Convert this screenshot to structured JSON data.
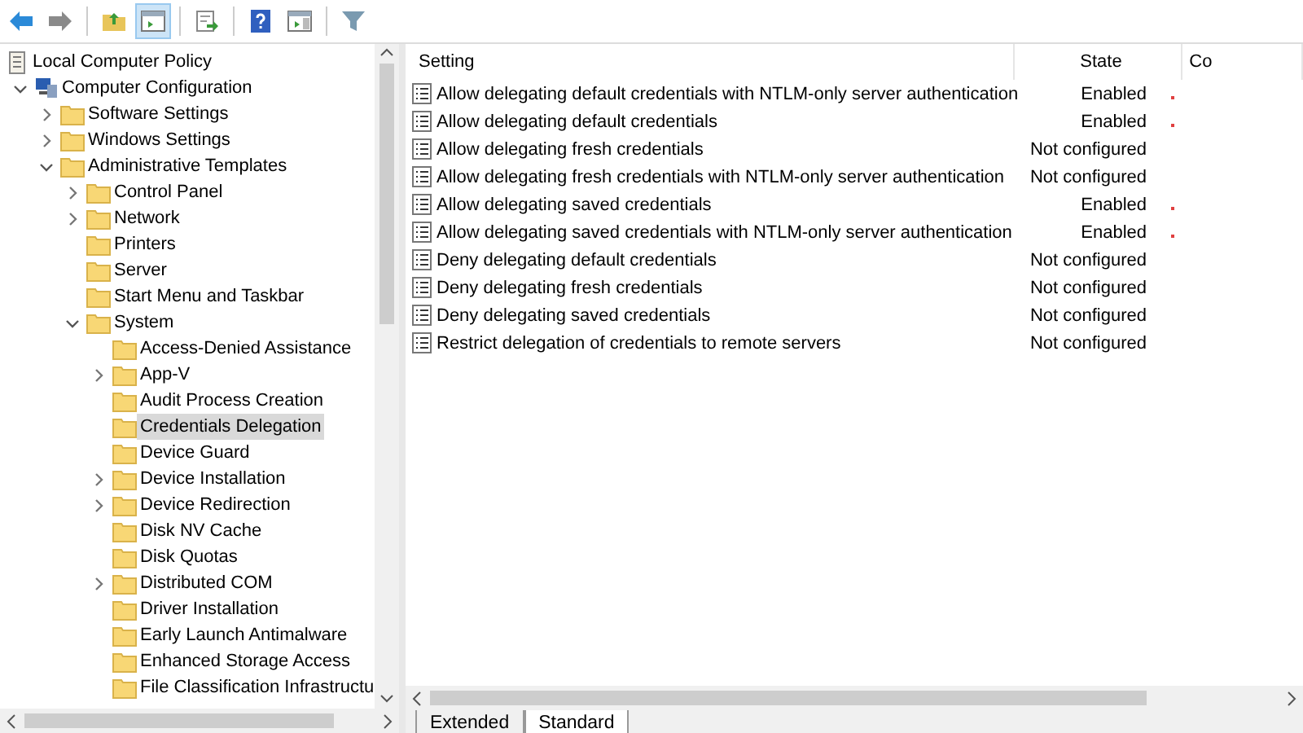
{
  "toolbar": {
    "buttons": [
      {
        "kind": "back",
        "selected": false
      },
      {
        "kind": "forward",
        "selected": false
      },
      {
        "kind": "up",
        "selected": false
      },
      {
        "kind": "tree",
        "selected": true
      },
      {
        "kind": "export",
        "selected": false
      },
      {
        "kind": "help",
        "selected": false
      },
      {
        "kind": "view",
        "selected": false
      },
      {
        "kind": "filter",
        "selected": false
      }
    ]
  },
  "tree": {
    "items": [
      {
        "label": "Local Computer Policy",
        "kind": "policy",
        "selected": false,
        "children": [
          {
            "label": "Computer Configuration",
            "kind": "computer",
            "expanded": true,
            "selected": false,
            "children": [
              {
                "label": "Software Settings",
                "kind": "folder",
                "expanded": false,
                "selected": false
              },
              {
                "label": "Windows Settings",
                "kind": "folder",
                "expanded": false,
                "selected": false
              },
              {
                "label": "Administrative Templates",
                "kind": "folder",
                "expanded": true,
                "selected": false,
                "children": [
                  {
                    "label": "Control Panel",
                    "kind": "folder",
                    "expanded": false,
                    "selected": false
                  },
                  {
                    "label": "Network",
                    "kind": "folder",
                    "expanded": false,
                    "selected": false
                  },
                  {
                    "label": "Printers",
                    "kind": "folder",
                    "selected": false
                  },
                  {
                    "label": "Server",
                    "kind": "folder",
                    "selected": false
                  },
                  {
                    "label": "Start Menu and Taskbar",
                    "kind": "folder",
                    "selected": false
                  },
                  {
                    "label": "System",
                    "kind": "folder",
                    "expanded": true,
                    "selected": false,
                    "children": [
                      {
                        "label": "Access-Denied Assistance",
                        "kind": "folder",
                        "selected": false
                      },
                      {
                        "label": "App-V",
                        "kind": "folder",
                        "expanded": false,
                        "selected": false
                      },
                      {
                        "label": "Audit Process Creation",
                        "kind": "folder",
                        "selected": false
                      },
                      {
                        "label": "Credentials Delegation",
                        "kind": "folder",
                        "selected": true
                      },
                      {
                        "label": "Device Guard",
                        "kind": "folder",
                        "selected": false
                      },
                      {
                        "label": "Device Installation",
                        "kind": "folder",
                        "expanded": false,
                        "selected": false
                      },
                      {
                        "label": "Device Redirection",
                        "kind": "folder",
                        "expanded": false,
                        "selected": false
                      },
                      {
                        "label": "Disk NV Cache",
                        "kind": "folder",
                        "selected": false
                      },
                      {
                        "label": "Disk Quotas",
                        "kind": "folder",
                        "selected": false
                      },
                      {
                        "label": "Distributed COM",
                        "kind": "folder",
                        "expanded": false,
                        "selected": false
                      },
                      {
                        "label": "Driver Installation",
                        "kind": "folder",
                        "selected": false
                      },
                      {
                        "label": "Early Launch Antimalware",
                        "kind": "folder",
                        "selected": false
                      },
                      {
                        "label": "Enhanced Storage Access",
                        "kind": "folder",
                        "selected": false
                      },
                      {
                        "label": "File Classification Infrastructu",
                        "kind": "folder",
                        "selected": false
                      }
                    ]
                  }
                ]
              }
            ]
          }
        ]
      }
    ]
  },
  "table": {
    "columns": [
      "Setting",
      "State",
      "Co"
    ],
    "rows": [
      {
        "setting": "Allow delegating default credentials with NTLM-only server authentication",
        "state": "Enabled",
        "enabled": true
      },
      {
        "setting": "Allow delegating default credentials",
        "state": "Enabled",
        "enabled": true
      },
      {
        "setting": "Allow delegating fresh credentials",
        "state": "Not configured",
        "enabled": false
      },
      {
        "setting": "Allow delegating fresh credentials with NTLM-only server authentication",
        "state": "Not configured",
        "enabled": false
      },
      {
        "setting": "Allow delegating saved credentials",
        "state": "Enabled",
        "enabled": true
      },
      {
        "setting": "Allow delegating saved credentials with NTLM-only server authentication",
        "state": "Enabled",
        "enabled": true
      },
      {
        "setting": "Deny delegating default credentials",
        "state": "Not configured",
        "enabled": false
      },
      {
        "setting": "Deny delegating fresh credentials",
        "state": "Not configured",
        "enabled": false
      },
      {
        "setting": "Deny delegating saved credentials",
        "state": "Not configured",
        "enabled": false
      },
      {
        "setting": "Restrict delegation of credentials to remote servers",
        "state": "Not configured",
        "enabled": false
      }
    ]
  },
  "tabs": [
    {
      "label": "Extended",
      "selected": false
    },
    {
      "label": "Standard",
      "selected": true
    }
  ]
}
